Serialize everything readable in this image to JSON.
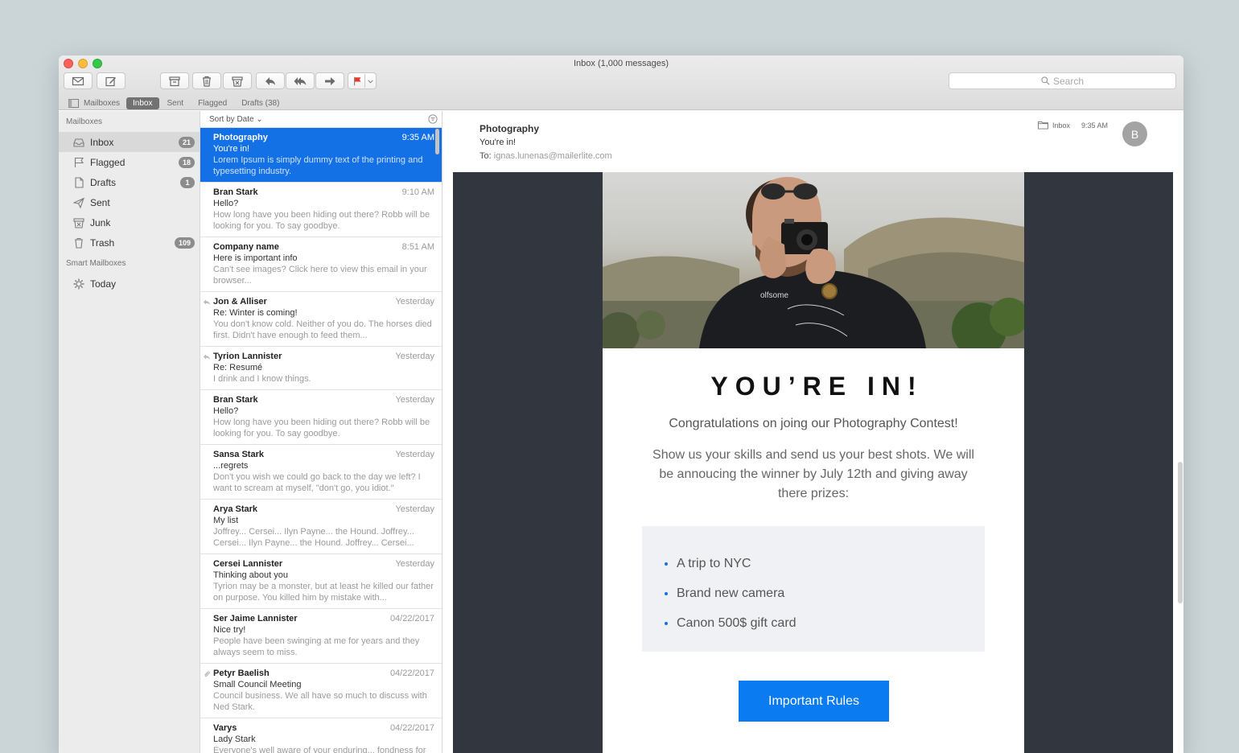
{
  "window": {
    "title": "Inbox (1,000 messages)"
  },
  "toolbar": {
    "search_placeholder": "Search",
    "colors": {
      "flag": "#e8372c"
    }
  },
  "favorites": {
    "mailboxes": "Mailboxes",
    "items": [
      "Inbox",
      "Sent",
      "Flagged",
      "Drafts (38)"
    ],
    "selected": "Inbox"
  },
  "sidebar": {
    "section1": "Mailboxes",
    "items": [
      {
        "label": "Inbox",
        "count": "21",
        "icon": "inbox-tray-icon"
      },
      {
        "label": "Flagged",
        "count": "18",
        "icon": "flag-icon"
      },
      {
        "label": "Drafts",
        "count": "1",
        "icon": "document-icon"
      },
      {
        "label": "Sent",
        "count": "",
        "icon": "paper-plane-icon"
      },
      {
        "label": "Junk",
        "count": "",
        "icon": "junk-bin-icon"
      },
      {
        "label": "Trash",
        "count": "109",
        "icon": "trash-icon"
      }
    ],
    "section2": "Smart Mailboxes",
    "smart": [
      {
        "label": "Today",
        "icon": "gear-icon"
      }
    ]
  },
  "list": {
    "sort_label": "Sort by Date",
    "messages": [
      {
        "from": "Photography",
        "date": "9:35 AM",
        "subject": "You're in!",
        "preview": "Lorem Ipsum is simply dummy text of the printing and typesetting industry."
      },
      {
        "from": "Bran Stark",
        "date": "9:10 AM",
        "subject": "Hello?",
        "preview": "How long have you been hiding out there? Robb will be looking for you. To say goodbye."
      },
      {
        "from": "Company name",
        "date": "8:51 AM",
        "subject": "Here is important info",
        "preview": "Can't see images? Click here to view this email in your browser..."
      },
      {
        "from": "Jon & Alliser",
        "date": "Yesterday",
        "subject": "Re: Winter is coming!",
        "preview": "You don't know cold. Neither of you do. The horses died first. Didn't have enough to feed them..."
      },
      {
        "from": "Tyrion Lannister",
        "date": "Yesterday",
        "subject": "Re: Resumé",
        "preview": "I drink and I know things."
      },
      {
        "from": "Bran Stark",
        "date": "Yesterday",
        "subject": "Hello?",
        "preview": "How long have you been hiding out there? Robb will be looking for you. To say goodbye."
      },
      {
        "from": "Sansa Stark",
        "date": "Yesterday",
        "subject": "...regrets",
        "preview": "Don't you wish we could go back to the day we left? I want to scream at myself, \"don't go, you idiot.\""
      },
      {
        "from": "Arya Stark",
        "date": "Yesterday",
        "subject": "My list",
        "preview": "Joffrey... Cersei... Ilyn Payne... the Hound. Joffrey... Cersei... Ilyn Payne... the Hound. Joffrey... Cersei..."
      },
      {
        "from": "Cersei Lannister",
        "date": "Yesterday",
        "subject": "Thinking about you",
        "preview": "Tyrion may be a monster, but at least he killed our father on purpose. You killed him by mistake with..."
      },
      {
        "from": "Ser Jaime Lannister",
        "date": "04/22/2017",
        "subject": "Nice try!",
        "preview": "People have been swinging at me for years and they always seem to miss."
      },
      {
        "from": "Petyr Baelish",
        "date": "04/22/2017",
        "subject": "Small Council Meeting",
        "preview": "Council business. We all have so much to discuss with Ned Stark."
      },
      {
        "from": "Varys",
        "date": "04/22/2017",
        "subject": "Lady Stark",
        "preview": "Everyone's well aware of your enduring... fondness for"
      }
    ]
  },
  "reader": {
    "from": "Photography",
    "subject": "You're in!",
    "to_label": "To:",
    "to_address": "ignas.lunenas@mailerlite.com",
    "mailbox": "Inbox",
    "time": "9:35 AM",
    "avatar_initial": "B"
  },
  "email": {
    "shirt_text": "olfsome",
    "headline": "YOU’RE IN!",
    "congrats": "Congratulations on joing our Photography Contest!",
    "body": "Show us your skills and send us your best shots. We will be annoucing the winner by July 12th and giving away there prizes:",
    "prizes": [
      "A trip to NYC",
      "Brand new camera",
      "Canon 500$ gift card"
    ],
    "cta": "Important Rules",
    "colors": {
      "cta": "#0a7bf0",
      "selection": "#1371e5"
    }
  }
}
